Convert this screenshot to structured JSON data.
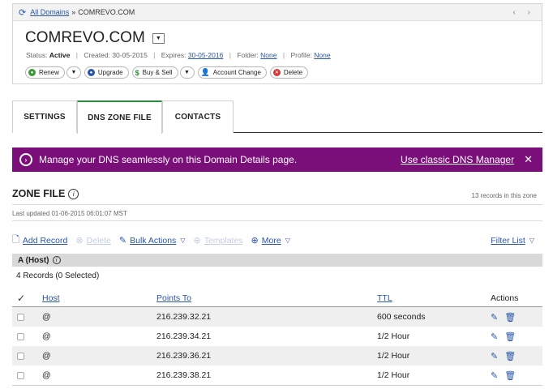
{
  "breadcrumb": {
    "root_link": "All Domains",
    "separator": "»",
    "current": "COMREVO.COM",
    "nav_arrows": "‹ ›"
  },
  "domain": {
    "name": "COMREVO.COM",
    "status_label": "Status:",
    "status_value": "Active",
    "created_label": "Created:",
    "created_value": "30-05-2015",
    "expires_label": "Expires:",
    "expires_value": "30-05-2016",
    "folder_label": "Folder:",
    "folder_value": "None",
    "profile_label": "Profile:",
    "profile_value": "None"
  },
  "actions": {
    "renew": "Renew",
    "upgrade": "Upgrade",
    "buy_sell": "Buy & Sell",
    "account_change": "Account Change",
    "delete": "Delete"
  },
  "tabs": [
    {
      "label": "SETTINGS",
      "active": false
    },
    {
      "label": "DNS ZONE FILE",
      "active": true
    },
    {
      "label": "CONTACTS",
      "active": false
    }
  ],
  "banner": {
    "message": "Manage your DNS seamlessly on this Domain Details page.",
    "link": "Use classic DNS Manager",
    "close": "✕",
    "color": "#7a0f7a"
  },
  "zone": {
    "title": "ZONE FILE",
    "record_count": "13 records in this zone",
    "last_updated": "Last updated 01-06-2015 06:01:07 MST"
  },
  "toolbar": {
    "add_record": "Add Record",
    "delete": "Delete",
    "bulk_actions": "Bulk Actions",
    "templates": "Templates",
    "more": "More",
    "filter_list": "Filter List"
  },
  "section": {
    "title": "A (Host)",
    "records_selected": "4 Records (0 Selected)"
  },
  "table": {
    "columns": {
      "host": "Host",
      "points_to": "Points To",
      "ttl": "TTL",
      "actions": "Actions"
    },
    "rows": [
      {
        "host": "@",
        "points_to": "216.239.32.21",
        "ttl": "600 seconds"
      },
      {
        "host": "@",
        "points_to": "216.239.34.21",
        "ttl": "1/2 Hour"
      },
      {
        "host": "@",
        "points_to": "216.239.36.21",
        "ttl": "1/2 Hour"
      },
      {
        "host": "@",
        "points_to": "216.239.38.21",
        "ttl": "1/2 Hour"
      }
    ]
  },
  "colors": {
    "link": "#2a55a8",
    "active_tab": "#2a8a3c",
    "banner": "#7a0f7a"
  }
}
